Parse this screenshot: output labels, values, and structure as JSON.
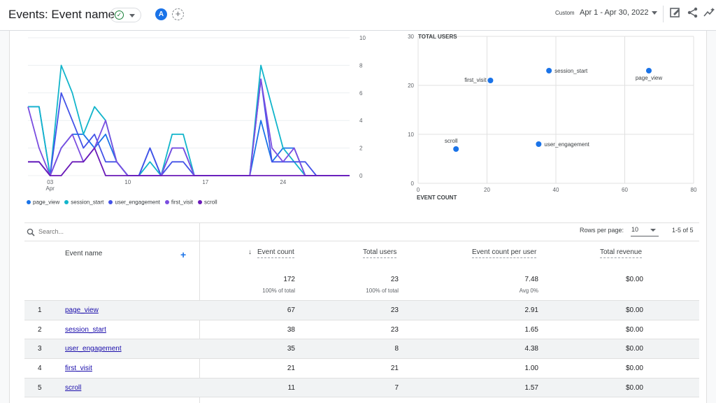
{
  "header": {
    "title": "Events: Event name",
    "comparison_avatar": "A",
    "date_prefix": "Custom",
    "date_range": "Apr 1 - Apr 30, 2022"
  },
  "colors": {
    "page_view": "#1a73e8",
    "session_start": "#12b5cb",
    "user_engagement": "#4352e8",
    "first_visit": "#7b4ee0",
    "scroll": "#6a1ab8",
    "accent": "#1a73e8"
  },
  "line_chart": {
    "legend": [
      {
        "key": "page_view",
        "label": "page_view"
      },
      {
        "key": "session_start",
        "label": "session_start"
      },
      {
        "key": "user_engagement",
        "label": "user_engagement"
      },
      {
        "key": "first_visit",
        "label": "first_visit"
      },
      {
        "key": "scroll",
        "label": "scroll"
      }
    ],
    "x_ticks": [
      {
        "day": 3,
        "label": "03",
        "sub": "Apr"
      },
      {
        "day": 10,
        "label": "10",
        "sub": ""
      },
      {
        "day": 17,
        "label": "17",
        "sub": ""
      },
      {
        "day": 24,
        "label": "24",
        "sub": ""
      }
    ],
    "y_ticks": [
      0,
      2,
      4,
      6,
      8,
      10
    ]
  },
  "scatter_chart": {
    "ylabel": "TOTAL USERS",
    "xlabel": "EVENT COUNT",
    "x_ticks": [
      0,
      20,
      40,
      60,
      80
    ],
    "y_ticks": [
      0,
      10,
      20,
      30
    ]
  },
  "chart_data": [
    {
      "type": "line",
      "x": [
        1,
        2,
        3,
        4,
        5,
        6,
        7,
        8,
        9,
        10,
        11,
        12,
        13,
        14,
        15,
        16,
        17,
        18,
        19,
        20,
        21,
        22,
        23,
        24,
        25,
        26,
        27,
        28,
        29,
        30
      ],
      "ylim": [
        0,
        10
      ],
      "series": [
        {
          "name": "page_view",
          "values": [
            5,
            5,
            0,
            2,
            3,
            3,
            2,
            3,
            1,
            0,
            0,
            2,
            0,
            2,
            2,
            0,
            0,
            0,
            0,
            0,
            0,
            4,
            1,
            2,
            2,
            0,
            0,
            0,
            0,
            0
          ]
        },
        {
          "name": "session_start",
          "values": [
            5,
            5,
            0,
            8,
            6,
            3,
            5,
            4,
            1,
            0,
            0,
            1,
            0,
            3,
            3,
            0,
            0,
            0,
            0,
            0,
            0,
            8,
            5,
            2,
            1,
            0,
            0,
            0,
            0,
            0
          ]
        },
        {
          "name": "user_engagement",
          "values": [
            1,
            1,
            0,
            6,
            4,
            2,
            3,
            1,
            1,
            0,
            0,
            2,
            0,
            1,
            1,
            0,
            0,
            0,
            0,
            0,
            0,
            7,
            1,
            1,
            1,
            1,
            0,
            0,
            0,
            0
          ]
        },
        {
          "name": "first_visit",
          "values": [
            5,
            2,
            0,
            2,
            3,
            1,
            2,
            4,
            1,
            0,
            0,
            0,
            0,
            2,
            2,
            0,
            0,
            0,
            0,
            0,
            0,
            7,
            2,
            1,
            2,
            0,
            0,
            0,
            0,
            0
          ]
        },
        {
          "name": "scroll",
          "values": [
            1,
            1,
            0,
            0,
            1,
            1,
            2,
            0,
            0,
            0,
            0,
            0,
            0,
            0,
            0,
            0,
            0,
            0,
            0,
            0,
            0,
            0,
            0,
            0,
            0,
            0,
            0,
            0,
            0,
            0
          ]
        }
      ]
    },
    {
      "type": "scatter",
      "xlabel": "EVENT COUNT",
      "ylabel": "TOTAL USERS",
      "xlim": [
        0,
        80
      ],
      "ylim": [
        0,
        30
      ],
      "points": [
        {
          "label": "page_view",
          "x": 67,
          "y": 23
        },
        {
          "label": "session_start",
          "x": 38,
          "y": 23
        },
        {
          "label": "user_engagement",
          "x": 35,
          "y": 8
        },
        {
          "label": "first_visit",
          "x": 21,
          "y": 21
        },
        {
          "label": "scroll",
          "x": 11,
          "y": 7
        }
      ]
    }
  ],
  "table": {
    "search_placeholder": "Search...",
    "rows_per_page_label": "Rows per page:",
    "rows_per_page_value": "10",
    "page_range": "1-5 of 5",
    "headers": {
      "dimension": "Event name",
      "event_count": "Event count",
      "total_users": "Total users",
      "events_per_user": "Event count per user",
      "total_revenue": "Total revenue"
    },
    "totals": {
      "event_count": "172",
      "event_count_sub": "100% of total",
      "total_users": "23",
      "total_users_sub": "100% of total",
      "events_per_user": "7.48",
      "events_per_user_sub": "Avg 0%",
      "total_revenue": "$0.00"
    },
    "rows": [
      {
        "idx": "1",
        "name": "page_view",
        "count": "67",
        "users": "23",
        "per_user": "2.91",
        "revenue": "$0.00"
      },
      {
        "idx": "2",
        "name": "session_start",
        "count": "38",
        "users": "23",
        "per_user": "1.65",
        "revenue": "$0.00"
      },
      {
        "idx": "3",
        "name": "user_engagement",
        "count": "35",
        "users": "8",
        "per_user": "4.38",
        "revenue": "$0.00"
      },
      {
        "idx": "4",
        "name": "first_visit",
        "count": "21",
        "users": "21",
        "per_user": "1.00",
        "revenue": "$0.00"
      },
      {
        "idx": "5",
        "name": "scroll",
        "count": "11",
        "users": "7",
        "per_user": "1.57",
        "revenue": "$0.00"
      }
    ]
  }
}
